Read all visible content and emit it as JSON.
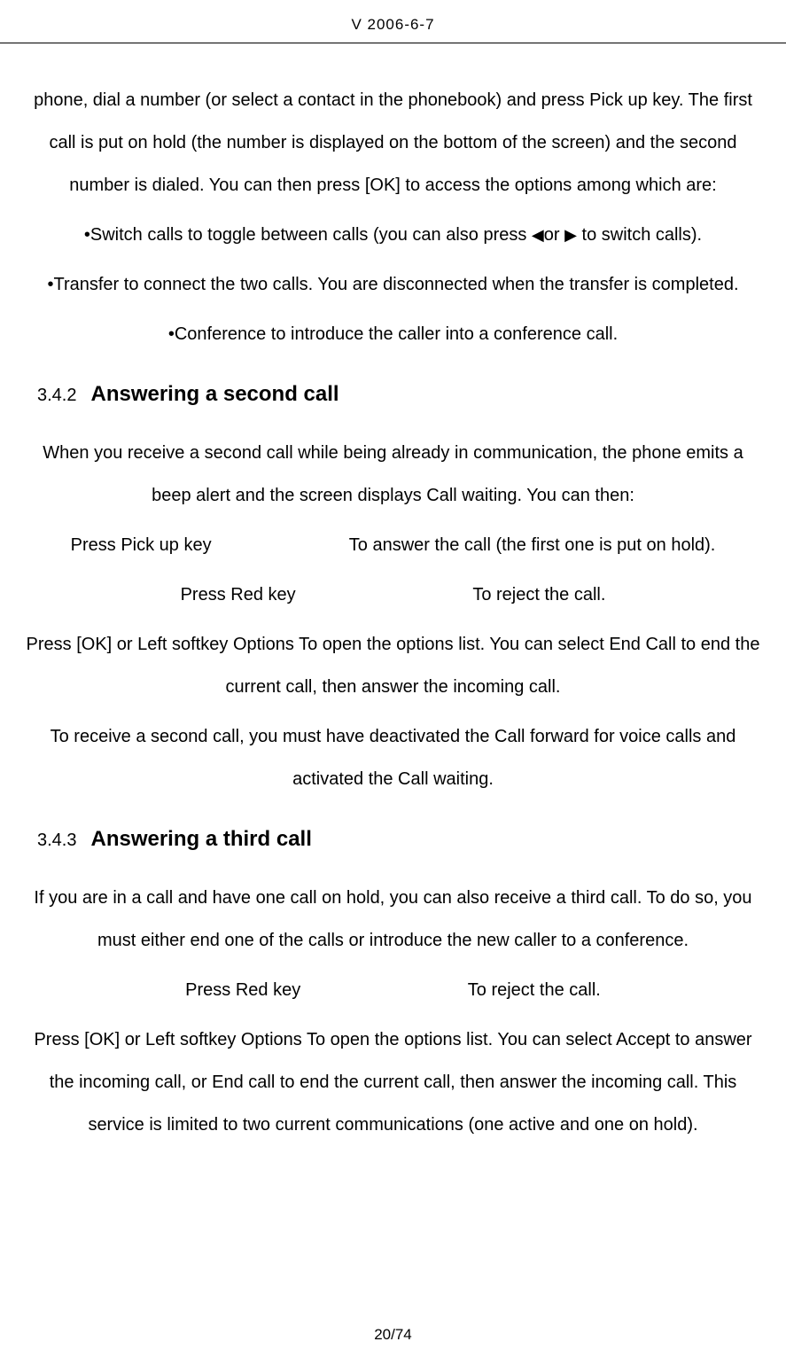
{
  "header": {
    "version": "V 2006-6-7"
  },
  "body": {
    "intro": "phone, dial a number (or select a contact in the phonebook) and press Pick up key. The first call is put on hold (the number is displayed on the bottom of the screen) and the second number is dialed. You can then press [OK] to access the options among which are:",
    "bullet1_pre": "•Switch calls to toggle between calls (you can also press ",
    "bullet1_mid": "or ",
    "bullet1_post": " to switch calls).",
    "bullet2": "•Transfer to connect the two calls. You are disconnected when the transfer is completed.",
    "bullet3": "•Conference to introduce the caller into a conference call.",
    "sec342_num": "3.4.2",
    "sec342_title": "Answering a second call",
    "sec342_p1": "When you receive a second call while being already in communication, the phone emits a beep alert and the screen displays Call waiting. You can then:",
    "sec342_p2": "Press Pick up key                            To answer the call (the first one is put on hold).",
    "sec342_p3": "Press Red key                                    To reject the call.",
    "sec342_p4": "Press [OK] or Left softkey Options    To open the options list. You can select End Call to end the current call, then answer the incoming call.",
    "sec342_p5": "To receive a second call, you must have deactivated the Call forward for voice calls and activated the Call waiting.",
    "sec343_num": "3.4.3",
    "sec343_title": "Answering a third call",
    "sec343_p1": "If you are in a call and have one call on hold, you can also receive a third call. To do so, you must either end one of the calls or introduce the new caller to a conference.",
    "sec343_p2": "Press Red key                                  To reject the call.",
    "sec343_p3": "Press [OK] or Left softkey Options    To open the options list. You can select Accept to answer the incoming call, or End call to end the current call, then answer the incoming call. This service is limited to two current communications (one active and one on hold)."
  },
  "footer": {
    "page": "20/74"
  },
  "glyphs": {
    "left_tri": "◀",
    "right_tri": "▶"
  }
}
